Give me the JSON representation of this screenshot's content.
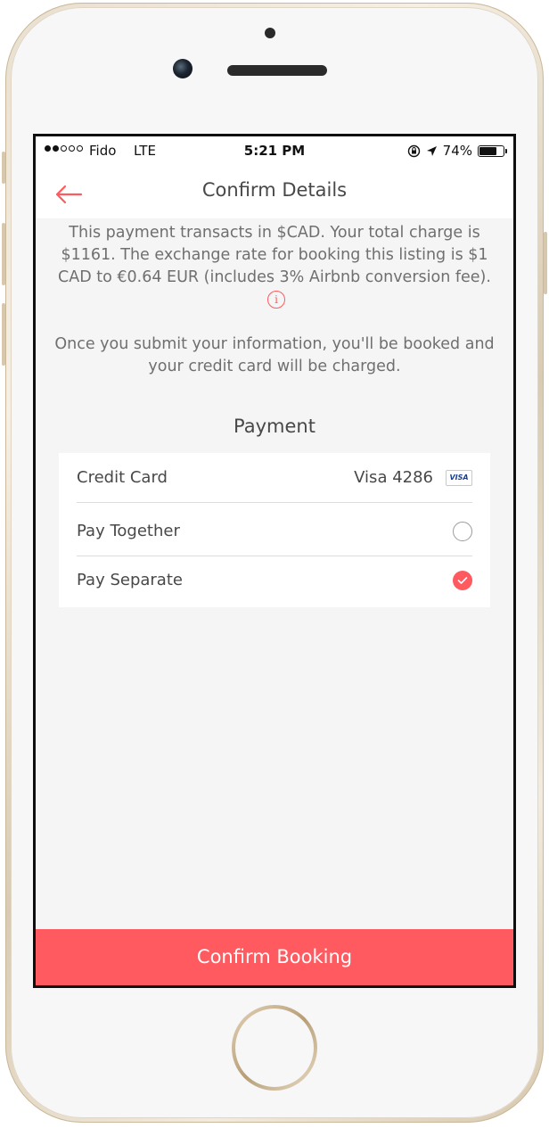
{
  "status_bar": {
    "carrier": "Fido",
    "network": "LTE",
    "time": "5:21 PM",
    "battery": "74%",
    "battery_level": 0.74,
    "signal_strength": 2,
    "signal_max": 5
  },
  "nav": {
    "title": "Confirm Details",
    "back_icon": "arrow-left-icon"
  },
  "info": {
    "text": "This payment transacts in $CAD. Your total charge is $1161. The exchange rate for booking this listing is $1 CAD to €0.64 EUR (includes 3% Airbnb conversion fee).",
    "icon": "i",
    "icon_name": "info-icon"
  },
  "notice": {
    "text": "Once you submit your information, you'll be booked and your credit card will be charged."
  },
  "payment": {
    "title": "Payment",
    "credit_card": {
      "label": "Credit Card",
      "value": "Visa 4286",
      "card_brand": "VISA"
    },
    "options": [
      {
        "label": "Pay Together",
        "selected": false
      },
      {
        "label": "Pay Separate",
        "selected": true
      }
    ]
  },
  "footer": {
    "confirm_label": "Confirm Booking"
  },
  "colors": {
    "accent": "#ff5a5f",
    "text": "#484848",
    "muted": "#6f6f6f",
    "background": "#f5f5f5"
  }
}
